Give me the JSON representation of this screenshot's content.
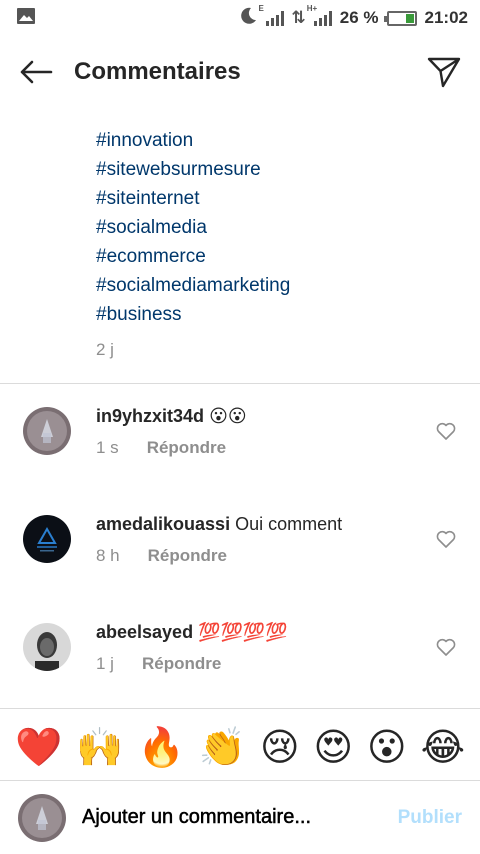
{
  "status_bar": {
    "battery": "26 %",
    "time": "21:02",
    "network_1": "E",
    "network_2": "H+",
    "icons": [
      "image-icon",
      "moon-icon",
      "signal-icon",
      "data-arrows-icon",
      "signal-icon",
      "battery-icon"
    ]
  },
  "header": {
    "title": "Commentaires",
    "back_icon": "arrow-left-icon",
    "share_icon": "paper-plane-icon"
  },
  "caption": {
    "hashtags": [
      "#innovation",
      "#sitewebsurmesure",
      "#siteinternet",
      "#socialmedia",
      "#ecommerce",
      "#socialmediamarketing",
      "#business"
    ],
    "time": "2 j"
  },
  "comments": [
    {
      "username": "in9yhzxit34d",
      "text": "😮😮",
      "time": "1 s",
      "reply": "Répondre"
    },
    {
      "username": "amedalikouassi",
      "text": "Oui comment",
      "time": "8 h",
      "reply": "Répondre"
    },
    {
      "username": "abeelsayed",
      "text": "💯💯💯💯",
      "time": "1 j",
      "reply": "Répondre"
    }
  ],
  "emoji_bar": [
    "❤️",
    "🙌",
    "🔥",
    "👏",
    "😢",
    "😍",
    "😮",
    "😂"
  ],
  "composer": {
    "placeholder": "Ajouter un commentaire...",
    "publish": "Publier"
  },
  "colors": {
    "hashtag": "#00376b",
    "secondary_text": "#8e8e8e",
    "publish_disabled": "#b2dffc",
    "divider": "#dbdbdb"
  }
}
